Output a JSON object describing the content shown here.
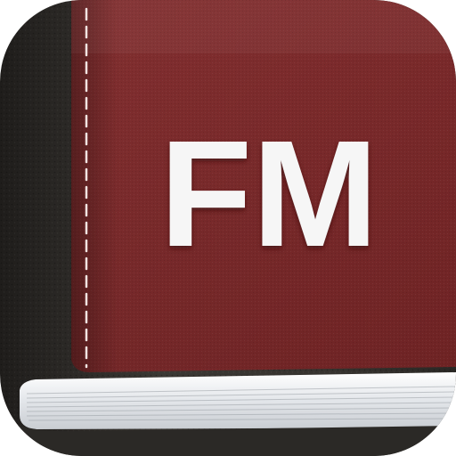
{
  "icon": {
    "label": "FM",
    "colors": {
      "cover": "#7d2a2b",
      "cover_highlight": "#8e3536",
      "spine": "#3a3733",
      "spine_dark": "#24221f",
      "pages": "#e9ecef",
      "label_text": "#f6f6f6",
      "stitching": "#f2e4e2"
    }
  }
}
